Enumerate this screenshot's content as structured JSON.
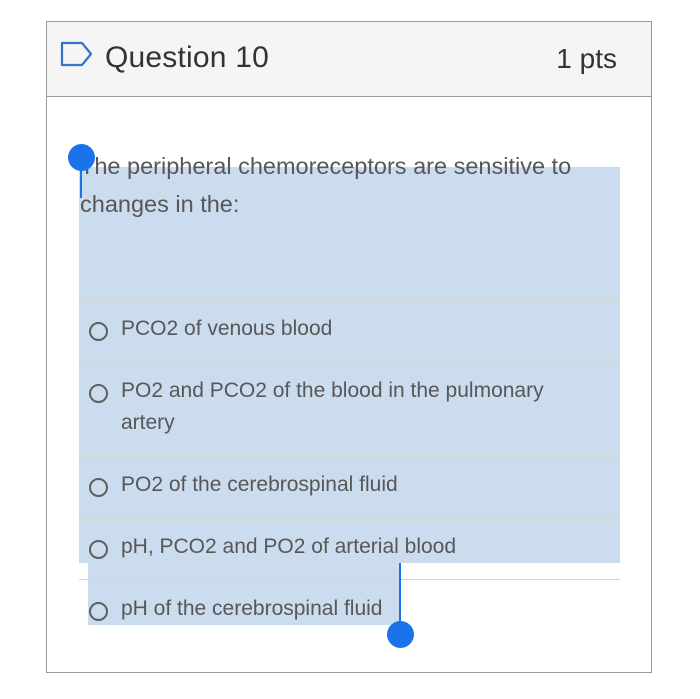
{
  "question": {
    "title": "Question 10",
    "points": "1 pts",
    "text": "The peripheral chemoreceptors are sensitive to changes in the:"
  },
  "answers": [
    {
      "label": "PCO2 of venous blood",
      "selected": false
    },
    {
      "label": "PO2 and PCO2 of the blood in the pulmonary artery",
      "selected": false
    },
    {
      "label": "PO2 of the cerebrospinal fluid",
      "selected": false
    },
    {
      "label": "pH, PCO2 and PO2 of arterial blood",
      "selected": false
    },
    {
      "label": "pH of the cerebrospinal fluid",
      "selected": false
    }
  ],
  "text_selection": {
    "active": true,
    "highlight_color": "#cbdcee",
    "handle_color": "#1a73e8"
  },
  "icons": {
    "flag": "flag-icon",
    "radio": "radio-unchecked-icon"
  }
}
